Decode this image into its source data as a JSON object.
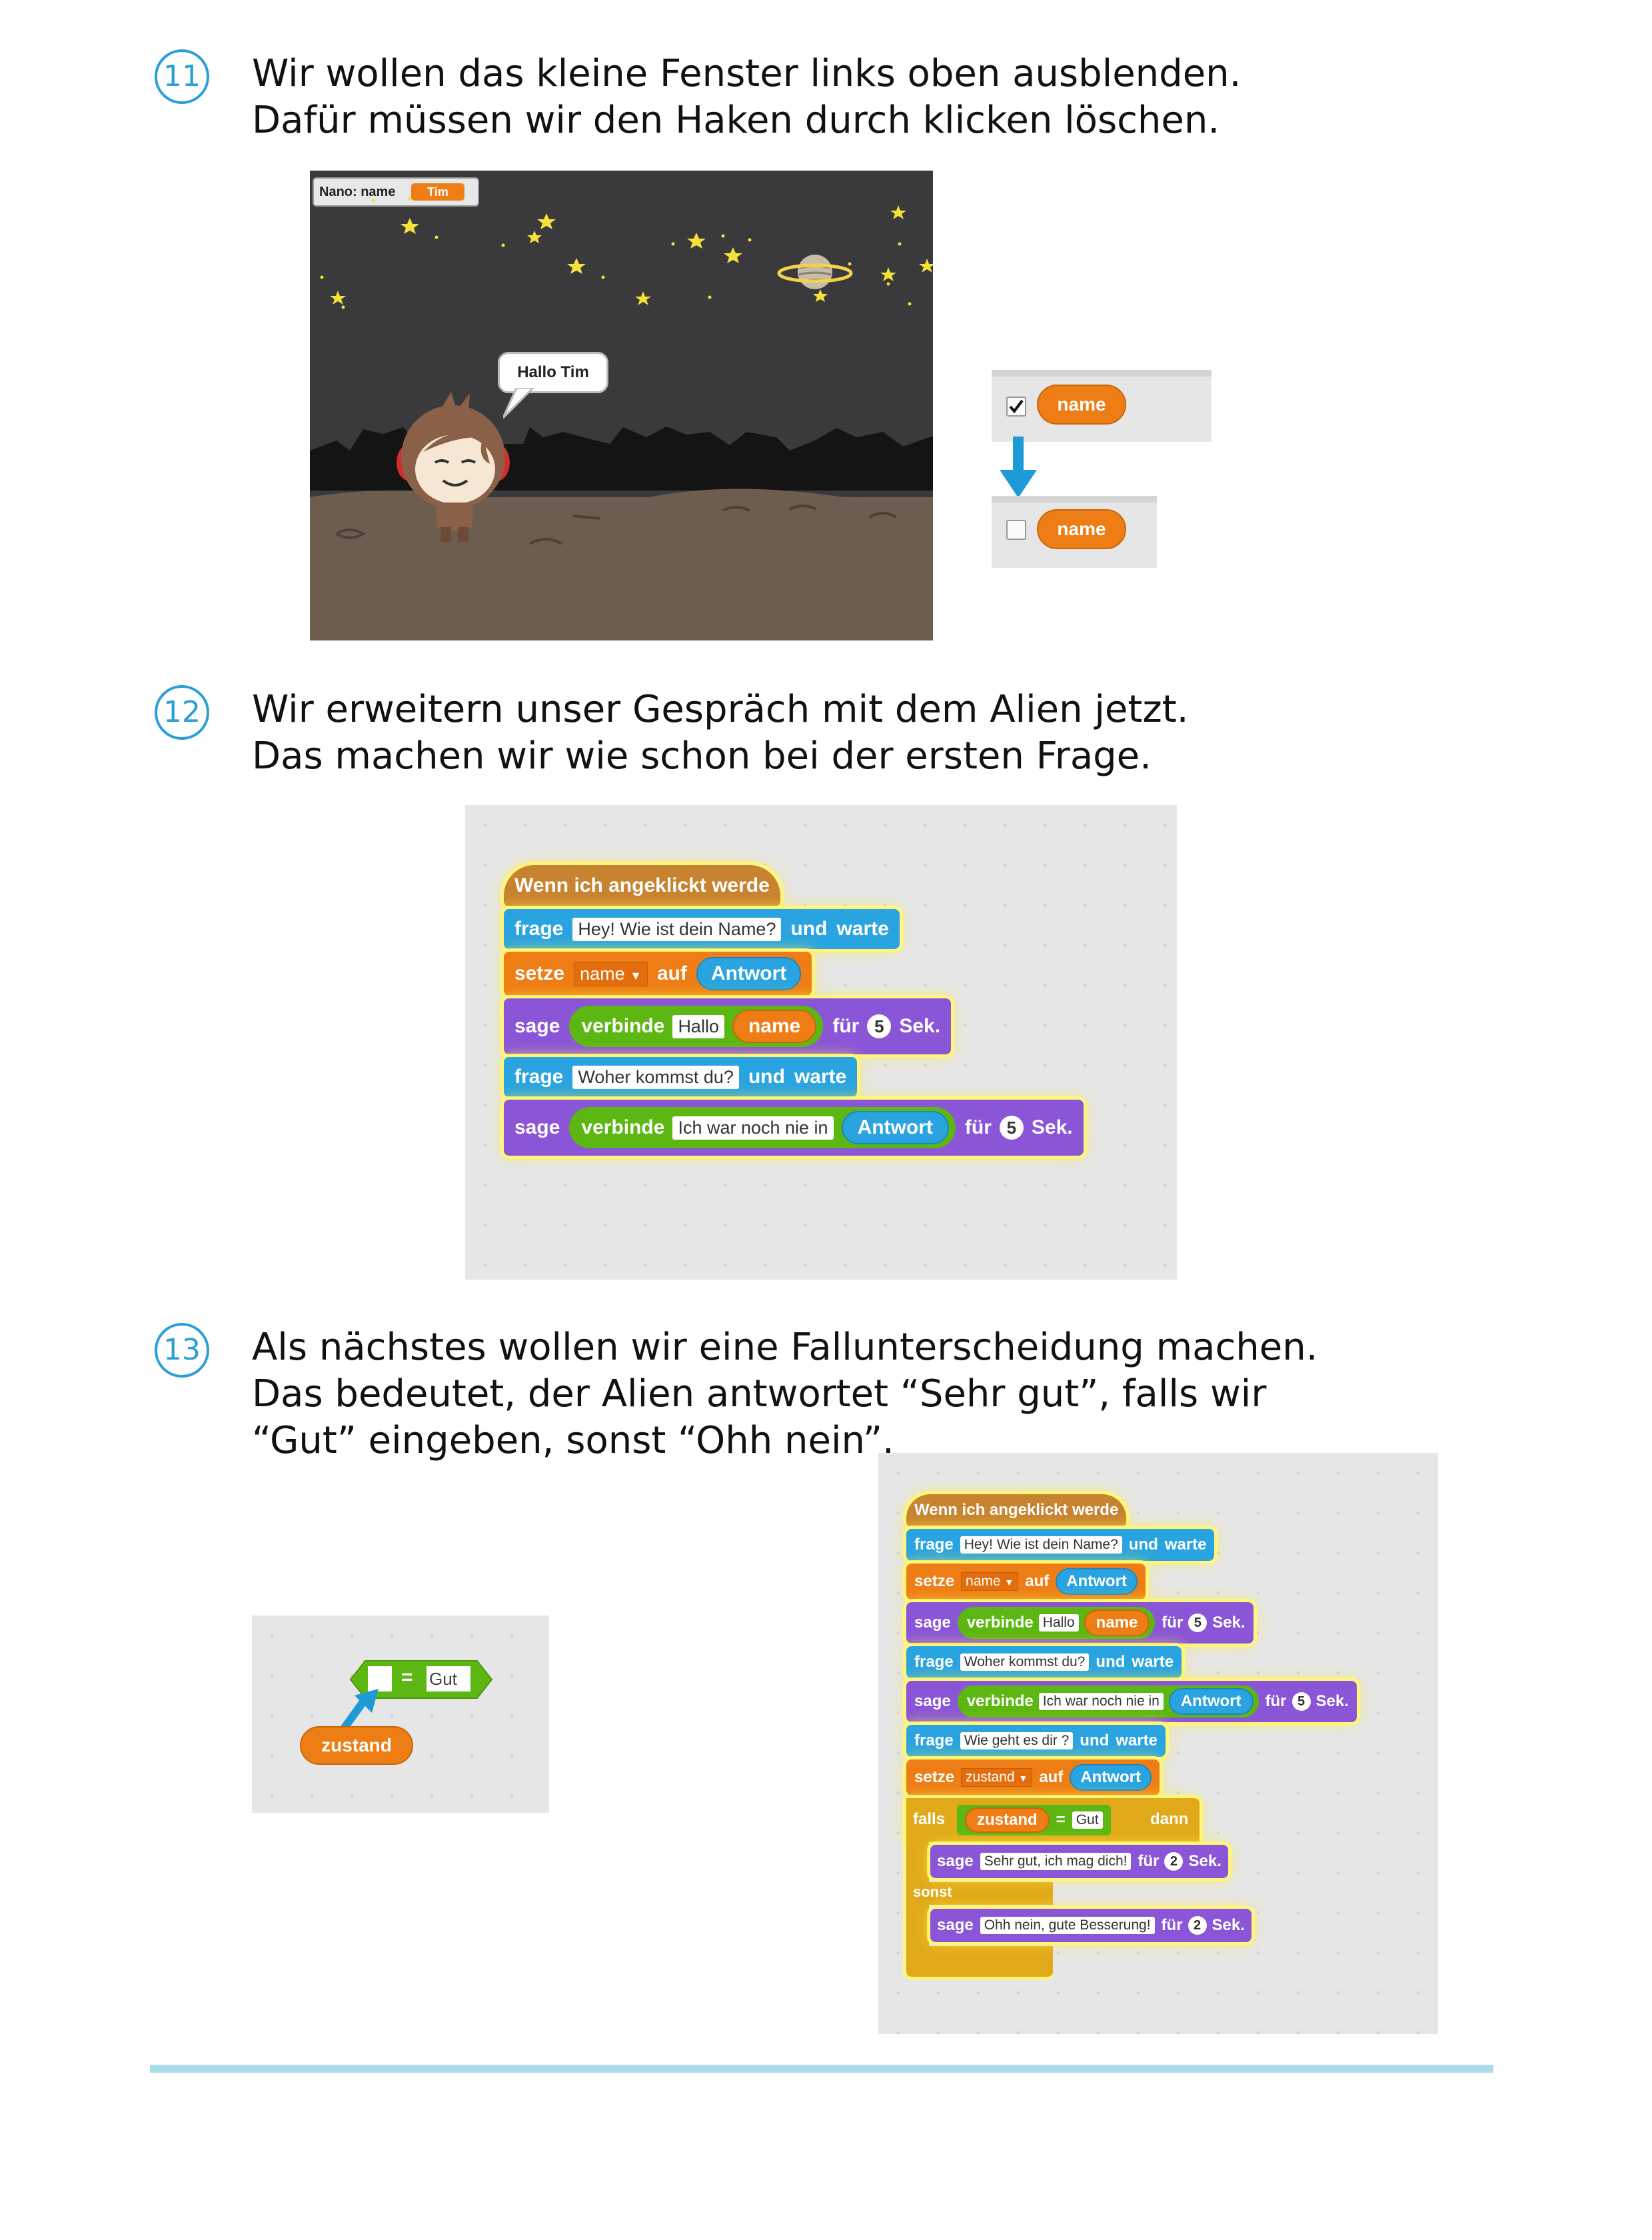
{
  "steps": [
    {
      "number": "11",
      "lines": [
        "Wir wollen das kleine Fenster links oben ausblenden.",
        "Dafür müssen wir den Haken durch klicken löschen."
      ]
    },
    {
      "number": "12",
      "lines": [
        "Wir erweitern unser Gespräch mit dem Alien jetzt.",
        "Das machen wir wie schon bei der ersten Frage."
      ]
    },
    {
      "number": "13",
      "lines": [
        "Als nächstes wollen wir eine Fallunterscheidung machen.",
        "Das bedeutet, der Alien antwortet “Sehr gut”, falls wir",
        "“Gut” eingeben, sonst “Ohh nein”."
      ]
    }
  ],
  "stage": {
    "monitor_label": "Nano: name",
    "monitor_value": "Tim",
    "speech": "Hallo Tim"
  },
  "checkbox_demo": {
    "variable": "name"
  },
  "colors": {
    "accent": "#2a9fd8",
    "events": "#c88330",
    "sensing": "#2aa4e0",
    "data": "#ee7d16",
    "looks": "#8a55d7",
    "control": "#e1a91a",
    "operators": "#5cb712",
    "rule": "#a9dcea"
  },
  "script1": {
    "hat": "Wenn ich angeklickt werde",
    "frage": "frage",
    "und": "und",
    "warte": "warte",
    "setze": "setze",
    "auf": "auf",
    "sage": "sage",
    "verbinde": "verbinde",
    "fuer": "für",
    "sek": "Sek.",
    "q1": "Hey! Wie ist dein Name?",
    "var_name": "name",
    "antwort": "Antwort",
    "hallo": "Hallo",
    "five": "5",
    "q2": "Woher kommst du?",
    "ich": "Ich war noch nie in"
  },
  "compare": {
    "value": "Gut",
    "eq": "=",
    "reporter": "zustand"
  },
  "script2": {
    "q3": "Wie geht es dir ?",
    "var_zustand": "zustand",
    "falls": "falls",
    "dann": "dann",
    "sonst": "sonst",
    "gut": "Gut",
    "eq": "=",
    "say1": "Sehr gut, ich mag dich!",
    "say2": "Ohh nein, gute Besserung!",
    "two": "2"
  }
}
